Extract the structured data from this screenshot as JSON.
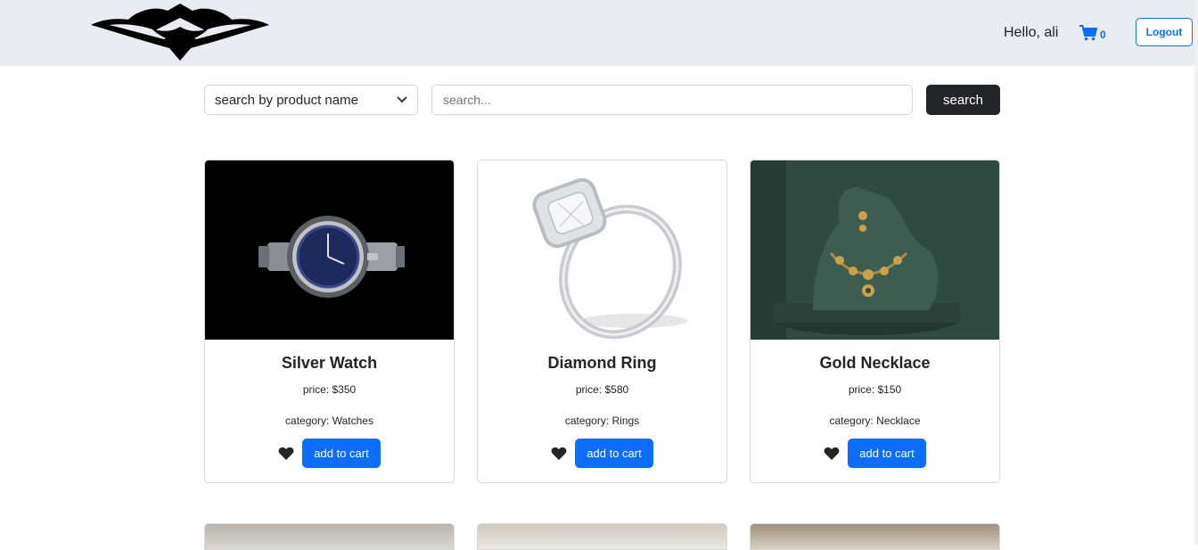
{
  "header": {
    "greeting": "Hello, ali",
    "cart_count": "0",
    "logout_label": "Logout"
  },
  "search": {
    "filter_selected": "search by product name",
    "placeholder": "search...",
    "button_label": "search"
  },
  "products": [
    {
      "name": "Silver Watch",
      "price": "price: $350",
      "category": "category: Watches",
      "add_label": "add to cart"
    },
    {
      "name": "Diamond Ring",
      "price": "price: $580",
      "category": "category: Rings",
      "add_label": "add to cart"
    },
    {
      "name": "Gold Necklace",
      "price": "price: $150",
      "category": "category: Necklace",
      "add_label": "add to cart"
    }
  ],
  "icons": {
    "cart": "shopping-cart-icon",
    "heart": "heart-icon",
    "select_arrow": "chevron-down-icon"
  },
  "colors": {
    "primary": "#0d6efd",
    "dark": "#212529",
    "navbar_bg": "#e9ecf3"
  }
}
